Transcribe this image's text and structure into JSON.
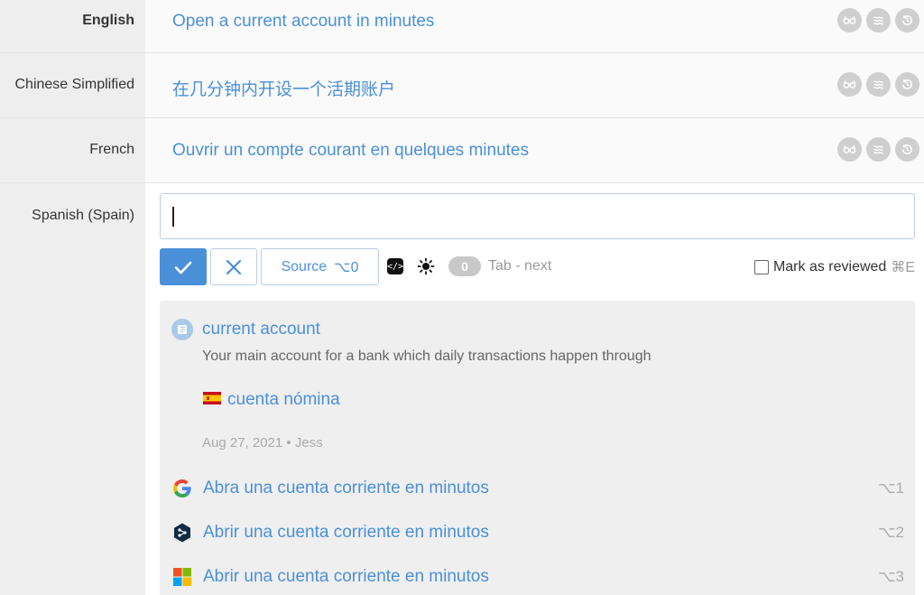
{
  "rows": [
    {
      "language": "English",
      "text": "Open a current account in minutes"
    },
    {
      "language": "Chinese Simplified",
      "text": "在几分钟内开设一个活期账户"
    },
    {
      "language": "French",
      "text": "Ouvrir un compte courant en quelques minutes"
    }
  ],
  "active": {
    "language": "Spanish (Spain)",
    "value": ""
  },
  "toolbar": {
    "source_label": "Source",
    "source_shortcut": "⌥0",
    "counter": "0",
    "tab_hint": "Tab - next",
    "mark_reviewed_label": "Mark as reviewed",
    "mark_reviewed_shortcut": "⌘E"
  },
  "glossary": {
    "term": "current account",
    "description": "Your main account for a bank which daily transactions happen through",
    "translation": "cuenta nómina",
    "meta": "Aug 27, 2021 • Jess"
  },
  "machine_translations": [
    {
      "provider_icon": "google-logo-icon",
      "text": "Abra una cuenta corriente en minutos",
      "shortcut": "⌥1"
    },
    {
      "provider_icon": "deepl-logo-icon",
      "text": "Abrir una cuenta corriente en minutos",
      "shortcut": "⌥2"
    },
    {
      "provider_icon": "microsoft-logo-icon",
      "text": "Abrir una cuenta corriente en minutos",
      "shortcut": "⌥3"
    }
  ],
  "colors": {
    "accent": "#4a90d9",
    "label_bg": "#eeeeee",
    "panel_bg": "#efefef"
  }
}
